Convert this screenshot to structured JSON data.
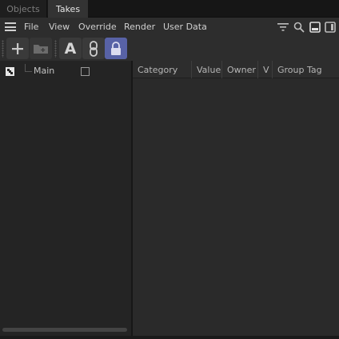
{
  "tabs": [
    {
      "label": "Objects",
      "active": false
    },
    {
      "label": "Takes",
      "active": true
    }
  ],
  "menu": {
    "items": [
      "File",
      "View",
      "Override",
      "Render",
      "User Data"
    ],
    "icons": [
      "hamburger-icon",
      "filter-icon",
      "search-icon",
      "single-view-icon",
      "split-view-icon"
    ]
  },
  "toolbar": {
    "buttons": [
      {
        "name": "add-take",
        "icon": "plus-icon"
      },
      {
        "name": "add-folder",
        "icon": "folder-plus-icon",
        "enabled": false
      },
      {
        "name": "auto-take",
        "icon": "letter-a-icon"
      },
      {
        "name": "link",
        "icon": "link-icon"
      },
      {
        "name": "lock-overrides",
        "icon": "lock-icon",
        "active": true
      }
    ],
    "auto_take_glyph": "A"
  },
  "tree": {
    "root_label": "Main",
    "root_checked": false
  },
  "columns": [
    "Category",
    "Value",
    "Owner",
    "V",
    "Group Tag"
  ],
  "colors": {
    "accent": "#5862a6",
    "panel": "#242424",
    "menubar": "#2d2d2d",
    "text": "#d0d0d0"
  }
}
